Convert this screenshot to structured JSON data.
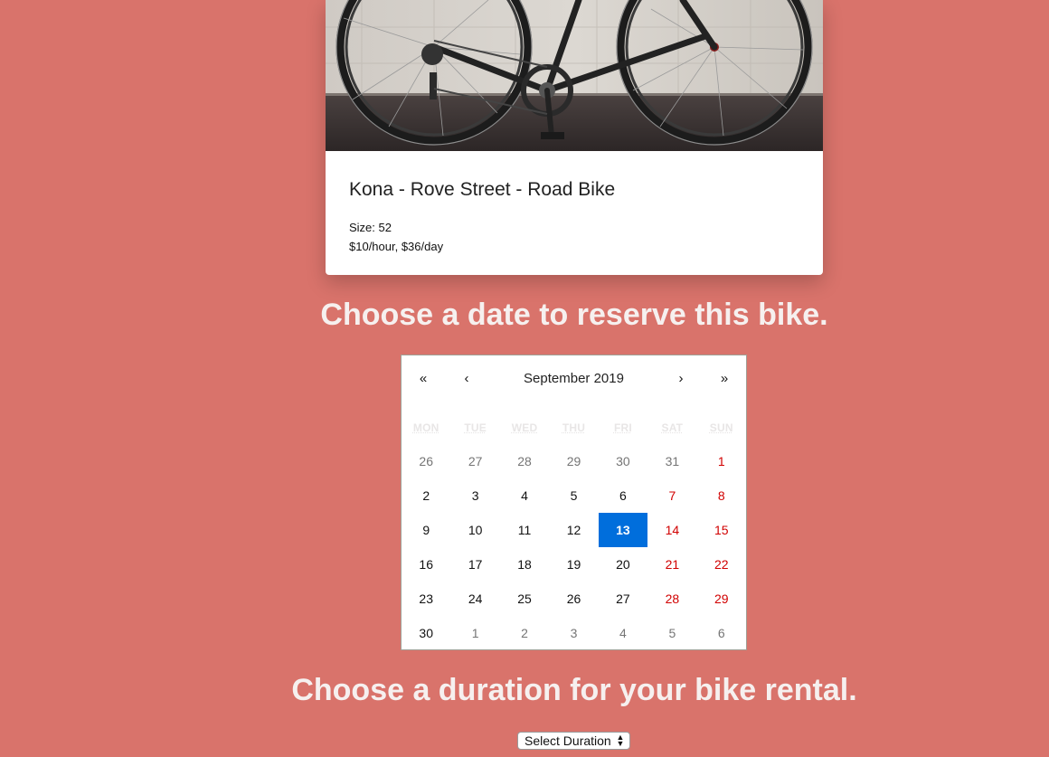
{
  "bike": {
    "title": "Kona - Rove Street - Road Bike",
    "size_line": "Size: 52",
    "price_line": "$10/hour, $36/day"
  },
  "headings": {
    "date": "Choose a date to reserve this bike.",
    "duration": "Choose a duration for your bike rental."
  },
  "calendar": {
    "nav": {
      "prev_year": "«",
      "prev_month": "‹",
      "label": "September 2019",
      "next_month": "›",
      "next_year": "»"
    },
    "weekdays": [
      "MON",
      "TUE",
      "WED",
      "THU",
      "FRI",
      "SAT",
      "SUN"
    ],
    "selected_day": "13",
    "days": [
      {
        "n": "26",
        "other": true
      },
      {
        "n": "27",
        "other": true
      },
      {
        "n": "28",
        "other": true
      },
      {
        "n": "29",
        "other": true
      },
      {
        "n": "30",
        "other": true
      },
      {
        "n": "31",
        "other": true
      },
      {
        "n": "1",
        "weekend": true
      },
      {
        "n": "2"
      },
      {
        "n": "3"
      },
      {
        "n": "4"
      },
      {
        "n": "5"
      },
      {
        "n": "6"
      },
      {
        "n": "7",
        "weekend": true
      },
      {
        "n": "8",
        "weekend": true
      },
      {
        "n": "9"
      },
      {
        "n": "10"
      },
      {
        "n": "11"
      },
      {
        "n": "12"
      },
      {
        "n": "13",
        "selected": true
      },
      {
        "n": "14",
        "weekend": true
      },
      {
        "n": "15",
        "weekend": true
      },
      {
        "n": "16"
      },
      {
        "n": "17"
      },
      {
        "n": "18"
      },
      {
        "n": "19"
      },
      {
        "n": "20"
      },
      {
        "n": "21",
        "weekend": true
      },
      {
        "n": "22",
        "weekend": true
      },
      {
        "n": "23"
      },
      {
        "n": "24"
      },
      {
        "n": "25"
      },
      {
        "n": "26"
      },
      {
        "n": "27"
      },
      {
        "n": "28",
        "weekend": true
      },
      {
        "n": "29",
        "weekend": true
      },
      {
        "n": "30"
      },
      {
        "n": "1",
        "other": true
      },
      {
        "n": "2",
        "other": true
      },
      {
        "n": "3",
        "other": true
      },
      {
        "n": "4",
        "other": true
      },
      {
        "n": "5",
        "other": true
      },
      {
        "n": "6",
        "other": true
      }
    ]
  },
  "duration_select": {
    "value": "Select Duration"
  },
  "colors": {
    "background": "#d9736b",
    "selected_day": "#006edc",
    "weekend_day": "#d10000"
  }
}
